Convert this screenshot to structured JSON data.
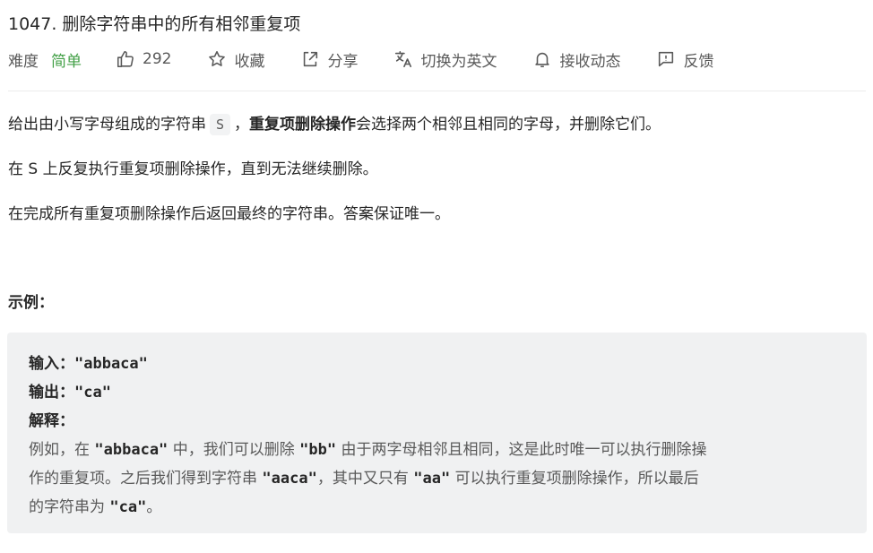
{
  "problem": {
    "title": "1047. 删除字符串中的所有相邻重复项",
    "difficulty_label": "难度",
    "difficulty_value": "简单",
    "likes": "292",
    "favorite_label": "收藏",
    "share_label": "分享",
    "translate_label": "切换为英文",
    "notify_label": "接收动态",
    "feedback_label": "反馈",
    "colors": {
      "difficulty_easy": "#43a047",
      "text": "#262626",
      "muted": "#595959"
    }
  },
  "description": {
    "p1_a": "给出由小写字母组成的字符串",
    "p1_code": "S",
    "p1_b": "，",
    "p1_strong": "重复项删除操作",
    "p1_c": "会选择两个相邻且相同的字母，并删除它们。",
    "p2": "在 S 上反复执行重复项删除操作，直到无法继续删除。",
    "p3": "在完成所有重复项删除操作后返回最终的字符串。答案保证唯一。"
  },
  "example": {
    "heading": "示例：",
    "input_label": "输入：",
    "input_value": "\"abbaca\"",
    "output_label": "输出：",
    "output_value": "\"ca\"",
    "explain_label": "解释：",
    "l1_a": "例如，在 ",
    "l1_code1": "\"abbaca\"",
    "l1_b": " 中，我们可以删除 ",
    "l1_code2": "\"bb\"",
    "l1_c": " 由于两字母相邻且相同，这是此时唯一可以执行删除操",
    "l2_a": "作的重复项。之后我们得到字符串 ",
    "l2_code": "\"aaca\"",
    "l2_b": "，其中又只有 ",
    "l2_code2": "\"aa\"",
    "l2_c": " 可以执行重复项删除操作，所以最后",
    "l3_a": "的字符串为 ",
    "l3_code": "\"ca\"",
    "l3_b": "。"
  },
  "icons": [
    "thumbs-up-icon",
    "star-icon",
    "share-icon",
    "translate-icon",
    "bell-icon",
    "feedback-icon"
  ]
}
